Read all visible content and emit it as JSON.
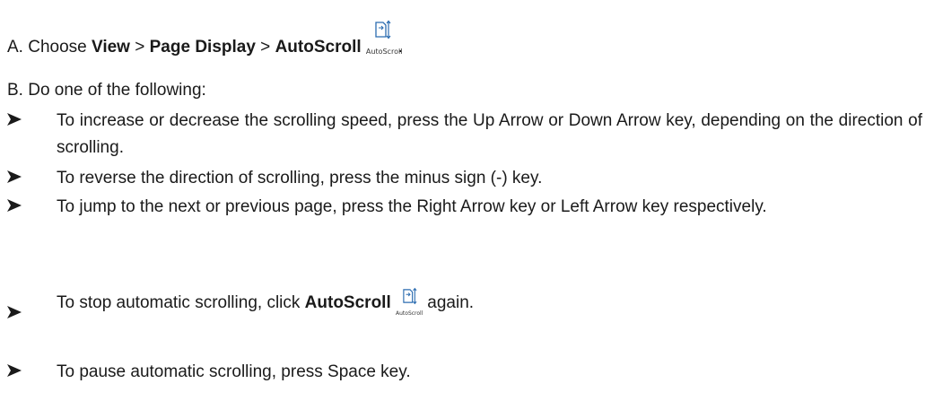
{
  "step_a": {
    "prefix": "A. Choose ",
    "view": "View",
    "sep1": " > ",
    "page_display": "Page Display",
    "sep2": " > ",
    "autoscroll": "AutoScroll",
    "icon_caption": "AutoScroll",
    "suffix": "."
  },
  "step_b": {
    "text": "B. Do one of the following:"
  },
  "bullets": [
    {
      "text": "To increase or decrease the scrolling speed, press the Up Arrow or Down Arrow key, depending on the direction of scrolling."
    },
    {
      "text": "To reverse the direction of scrolling, press the minus sign (-) key."
    },
    {
      "text": "To jump to the next or previous page, press the Right Arrow key or Left Arrow key respectively."
    },
    {
      "prefix": "To stop automatic scrolling, click ",
      "bold": "AutoScroll",
      "icon_caption": "AutoScroll",
      "suffix": " again."
    },
    {
      "text": "To pause automatic scrolling, press Space key."
    }
  ],
  "icons": {
    "bullet": "arrowhead-bullet-icon",
    "autoscroll": "autoscroll-icon"
  },
  "colors": {
    "text": "#1a1a1a",
    "icon_blue": "#2b6cb0"
  }
}
